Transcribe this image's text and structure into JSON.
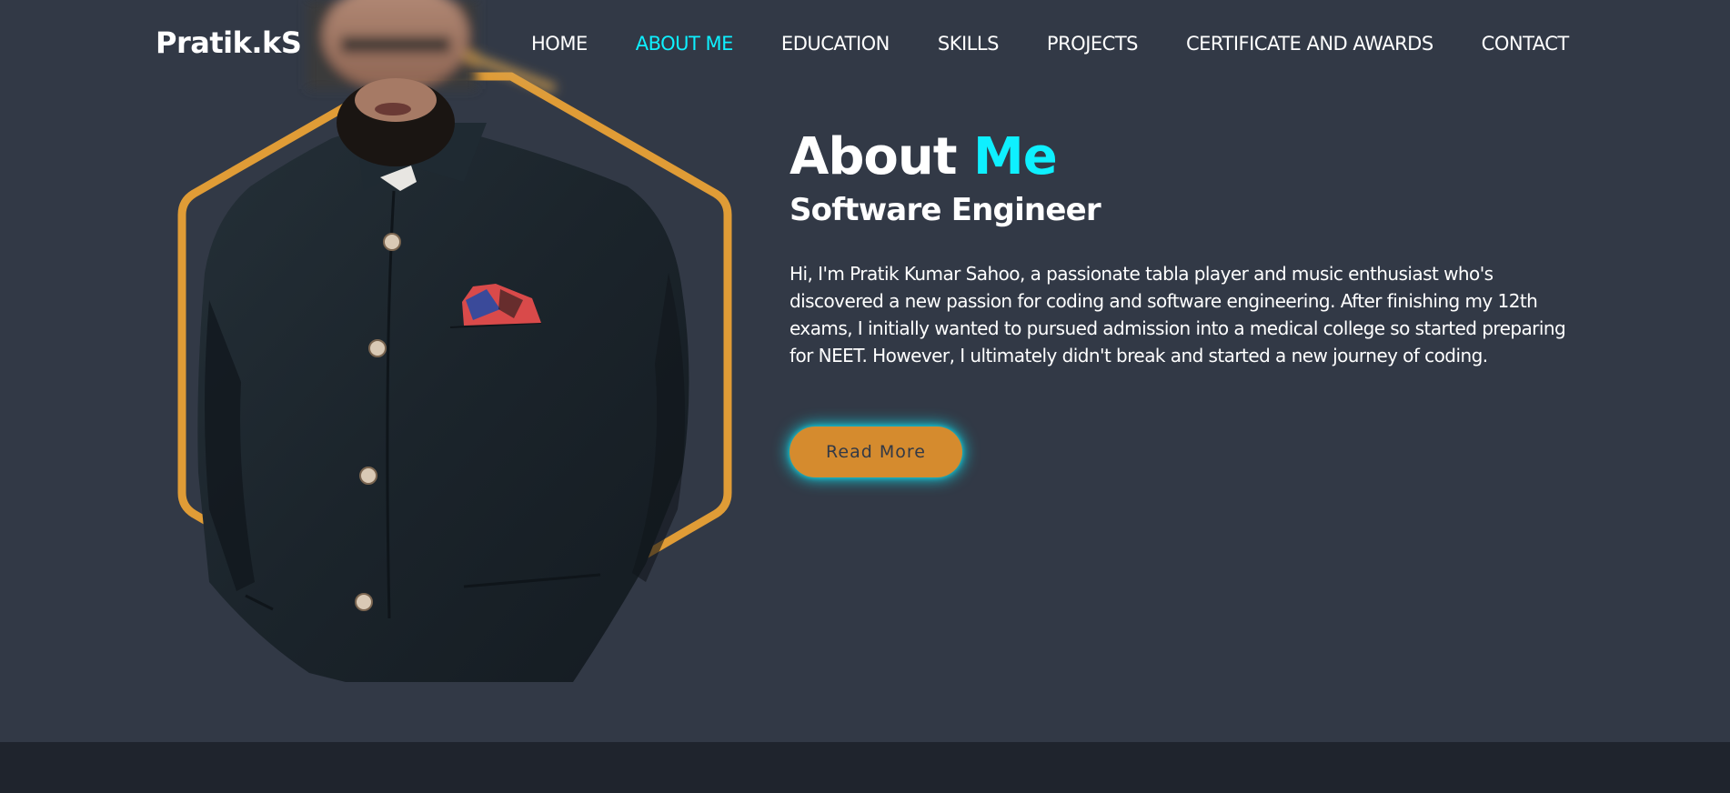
{
  "header": {
    "logo": "Pratik.kS",
    "nav": [
      {
        "label": "HOME",
        "active": false
      },
      {
        "label": "ABOUT ME",
        "active": true
      },
      {
        "label": "EDUCATION",
        "active": false
      },
      {
        "label": "SKILLS",
        "active": false
      },
      {
        "label": "PROJECTS",
        "active": false
      },
      {
        "label": "CERTIFICATE AND AWARDS",
        "active": false
      },
      {
        "label": "CONTACT",
        "active": false
      }
    ]
  },
  "about": {
    "heading_main": "About",
    "heading_accent": "Me",
    "subtitle": "Software Engineer",
    "bio": "Hi, I'm Pratik Kumar Sahoo, a passionate tabla player and music enthusiast who's discovered a new passion for coding and software engineering. After finishing my 12th exams, I initially wanted to pursued admission into a medical college so started preparing for NEET. However, I ultimately didn't break and started a new journey of coding.",
    "read_more": "Read More"
  },
  "colors": {
    "background": "#323946",
    "accent": "#0ef0ff",
    "button": "#d58b2e",
    "frame": "#e09c36",
    "footer": "#1f242d"
  },
  "icons": {
    "profile_photo": "profile-photo"
  }
}
